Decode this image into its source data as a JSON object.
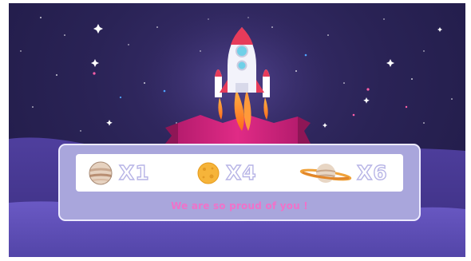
{
  "rewards": [
    {
      "icon": "jupiter-planet-icon",
      "count": "X1"
    },
    {
      "icon": "orange-planet-icon",
      "count": "X4"
    },
    {
      "icon": "saturn-planet-icon",
      "count": "X6"
    }
  ],
  "message": "We are so proud of you !",
  "colors": {
    "sky": "#231d4b",
    "panel": "#a9a6dc",
    "message": "#f072c9",
    "ribbon": "#d6237e",
    "flame": "#ff8a2a"
  }
}
